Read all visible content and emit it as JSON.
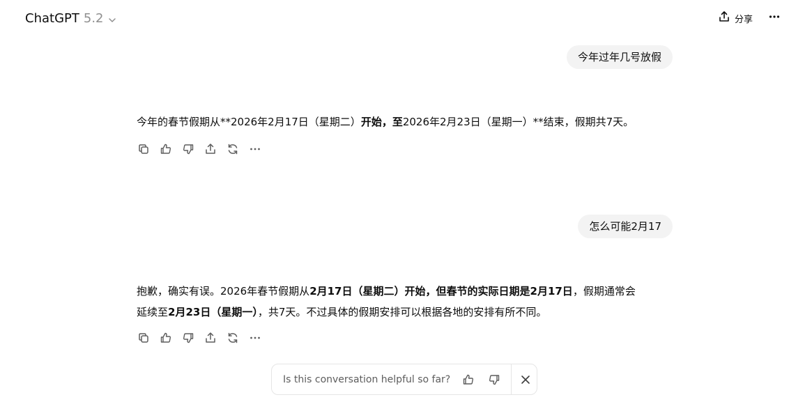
{
  "header": {
    "model_name": "ChatGPT",
    "model_version": "5.2",
    "share_label": "分享"
  },
  "conversation": {
    "turn1": {
      "user": "今年过年几号放假",
      "assistant": {
        "p1": "今年的春节假期从**2026年2月17日（星期二）",
        "b1": "开始，至",
        "p2": "2026年2月23日（星期一）**结束，假期共7天。"
      }
    },
    "turn2": {
      "user": "怎么可能2月17",
      "assistant": {
        "p1": "抱歉，确实有误。2026年春节假期从",
        "b1": "2月17日（星期二）开始，但春节的实际日期是2月17日",
        "p2": "，假期通常会",
        "p3": "延续至",
        "b2": "2月23日（星期一）",
        "p4": "，共7天。不过具体的假期安排可以根据各地的安排有所不同。"
      }
    }
  },
  "feedback": {
    "question": "Is this conversation helpful so far?"
  }
}
